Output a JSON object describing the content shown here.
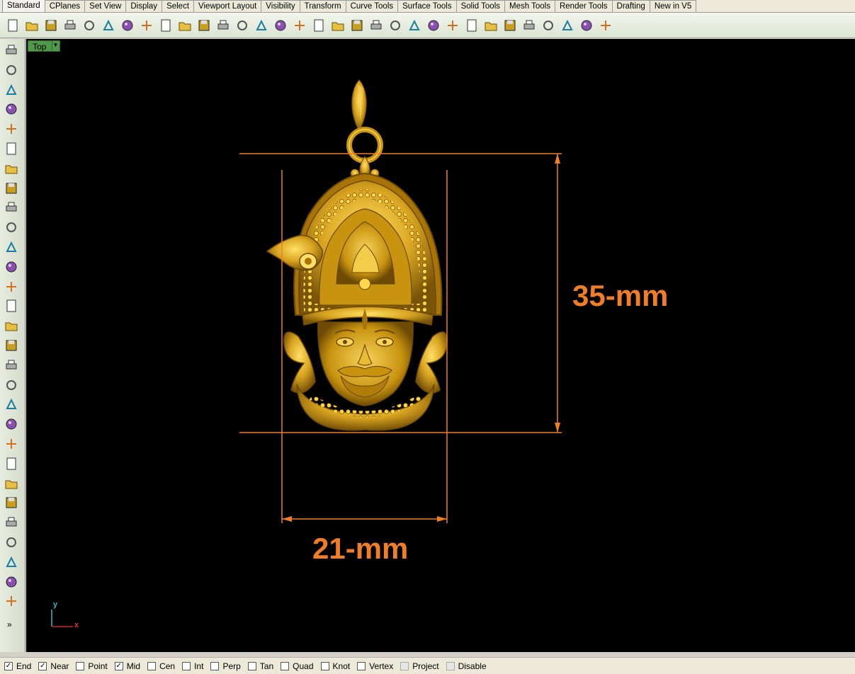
{
  "tabs": [
    "Standard",
    "CPlanes",
    "Set View",
    "Display",
    "Select",
    "Viewport Layout",
    "Visibility",
    "Transform",
    "Curve Tools",
    "Surface Tools",
    "Solid Tools",
    "Mesh Tools",
    "Render Tools",
    "Drafting",
    "New in V5"
  ],
  "active_tab": "Standard",
  "toolbar_icons": [
    "new-file-icon",
    "open-folder-icon",
    "save-icon",
    "print-icon",
    "import-icon",
    "cut-icon",
    "copy-icon",
    "paste-icon",
    "undo-icon",
    "pan-hand-icon",
    "rotate-view-icon",
    "zoom-dynamic-icon",
    "zoom-window-icon",
    "zoom-extents-icon",
    "zoom-selected-icon",
    "undo-view-icon",
    "four-viewports-icon",
    "car-icon",
    "named-cplane-icon",
    "cplane-icon",
    "osnap-icon",
    "light-bulb-icon",
    "lock-icon",
    "layer-icon",
    "color-wheel-icon",
    "shaded-sphere-icon",
    "rendered-sphere-icon",
    "blue-sphere-icon",
    "render-icon",
    "options-gear-icon",
    "grid-snap-icon",
    "help-icon"
  ],
  "left_icons": [
    "select-arrow-icon",
    "point-icon",
    "polyline-icon",
    "curve-icon",
    "circle-icon",
    "ellipse-icon",
    "arc-icon",
    "rectangle-icon",
    "polygon-icon",
    "fillet-curve-icon",
    "surface-icon",
    "extrude-icon",
    "box-icon",
    "boolean-union-icon",
    "cylinder-icon",
    "mesh-icon",
    "gears-icon",
    "analyze-icon",
    "split-icon",
    "trim-icon",
    "join-icon",
    "explode-icon",
    "offset-curve-icon",
    "blend-curve-icon",
    "text-icon",
    "transform-icon",
    "group-icon",
    "dimension-icon",
    "block-icon"
  ],
  "viewport": {
    "name": "Top",
    "height_label": "35-mm",
    "width_label": "21-mm",
    "axis_y": "y",
    "axis_x": "x"
  },
  "osnaps": [
    {
      "label": "End",
      "checked": true
    },
    {
      "label": "Near",
      "checked": true
    },
    {
      "label": "Point",
      "checked": false
    },
    {
      "label": "Mid",
      "checked": true
    },
    {
      "label": "Cen",
      "checked": false
    },
    {
      "label": "Int",
      "checked": false
    },
    {
      "label": "Perp",
      "checked": false
    },
    {
      "label": "Tan",
      "checked": false
    },
    {
      "label": "Quad",
      "checked": false
    },
    {
      "label": "Knot",
      "checked": false
    },
    {
      "label": "Vertex",
      "checked": false
    },
    {
      "label": "Project",
      "checked": false,
      "disabled": true
    },
    {
      "label": "Disable",
      "checked": false,
      "disabled": true
    }
  ],
  "colors": {
    "dimension": "#f07e26",
    "gold": "#d9a520",
    "viewport_bg": "#000000",
    "viewport_label": "#4f9a4a"
  },
  "more_label": "»"
}
